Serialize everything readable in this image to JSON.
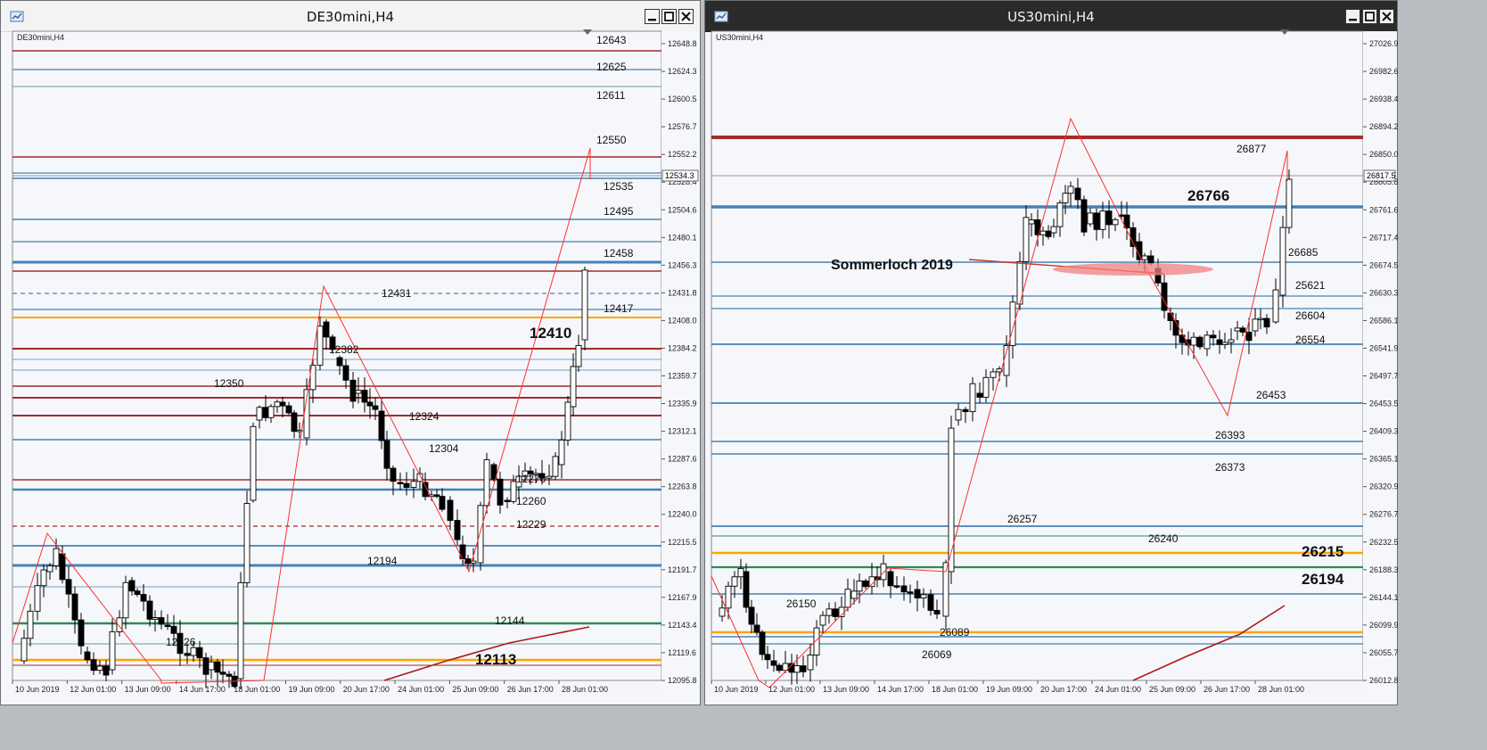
{
  "windows": [
    {
      "title": "DE30mini,H4",
      "symbol_label": "DE30mini,H4",
      "price_ticks": [
        "12648.8",
        "12624.3",
        "12600.5",
        "12576.7",
        "12552.2",
        "12528.4",
        "12504.6",
        "12480.1",
        "12456.3",
        "12431.8",
        "12408.0",
        "12384.2",
        "12359.7",
        "12335.9",
        "12312.1",
        "12287.6",
        "12263.8",
        "12240.0",
        "12215.5",
        "12191.7",
        "12167.9",
        "12143.4",
        "12119.6",
        "12095.8"
      ],
      "current_price": "12534.3",
      "time_ticks": [
        "10 Jun 2019",
        "12 Jun 01:00",
        "13 Jun 09:00",
        "14 Jun 17:00",
        "18 Jun 01:00",
        "19 Jun 09:00",
        "20 Jun 17:00",
        "24 Jun 01:00",
        "25 Jun 09:00",
        "26 Jun 17:00",
        "28 Jun 01:00"
      ],
      "level_labels": [
        {
          "text": "12643",
          "big": false
        },
        {
          "text": "12625",
          "big": false
        },
        {
          "text": "12611",
          "big": false
        },
        {
          "text": "12550",
          "big": false
        },
        {
          "text": "12535",
          "big": false
        },
        {
          "text": "12495",
          "big": false
        },
        {
          "text": "12458",
          "big": false
        },
        {
          "text": "12431",
          "big": false
        },
        {
          "text": "12417",
          "big": false
        },
        {
          "text": "12410",
          "big": true
        },
        {
          "text": "12382",
          "big": false
        },
        {
          "text": "12350",
          "big": false
        },
        {
          "text": "12324",
          "big": false
        },
        {
          "text": "12304",
          "big": false
        },
        {
          "text": "12270",
          "big": false
        },
        {
          "text": "12260",
          "big": false
        },
        {
          "text": "12229",
          "big": false
        },
        {
          "text": "12194",
          "big": false
        },
        {
          "text": "12144",
          "big": false
        },
        {
          "text": "12126",
          "big": false
        },
        {
          "text": "12113",
          "big": true
        }
      ]
    },
    {
      "title": "US30mini,H4",
      "symbol_label": "US30mini,H4",
      "price_ticks": [
        "27026.9",
        "26982.6",
        "26938.4",
        "26894.2",
        "26850.0",
        "26805.8",
        "26761.6",
        "26717.4",
        "26674.5",
        "26630.3",
        "26586.1",
        "26541.9",
        "26497.7",
        "26453.5",
        "26409.3",
        "26365.1",
        "26320.9",
        "26276.7",
        "26232.5",
        "26188.3",
        "26144.1",
        "26099.9",
        "26055.7",
        "26012.8"
      ],
      "current_price": "26817.5",
      "time_ticks": [
        "10 Jun 2019",
        "12 Jun 01:00",
        "13 Jun 09:00",
        "14 Jun 17:00",
        "18 Jun 01:00",
        "19 Jun 09:00",
        "20 Jun 17:00",
        "24 Jun 01:00",
        "25 Jun 09:00",
        "26 Jun 17:00",
        "28 Jun 01:00"
      ],
      "annotation": "Sommerloch 2019",
      "level_labels": [
        {
          "text": "26877",
          "big": false
        },
        {
          "text": "26766",
          "big": true
        },
        {
          "text": "26685",
          "big": false
        },
        {
          "text": "25621",
          "big": false
        },
        {
          "text": "26604",
          "big": false
        },
        {
          "text": "26554",
          "big": false
        },
        {
          "text": "26453",
          "big": false
        },
        {
          "text": "26393",
          "big": false
        },
        {
          "text": "26373",
          "big": false
        },
        {
          "text": "26257",
          "big": false
        },
        {
          "text": "26240",
          "big": false
        },
        {
          "text": "26215",
          "big": true
        },
        {
          "text": "26194",
          "big": true
        },
        {
          "text": "26150",
          "big": false
        },
        {
          "text": "26089",
          "big": false
        },
        {
          "text": "26069",
          "big": false
        }
      ]
    }
  ],
  "colors": {
    "red_level": "#a52a2a",
    "blue_level": "#4682b4",
    "orange_level": "#ffa500",
    "green_level": "#2e8b57",
    "zigzag": "#ff3030",
    "candle": "#000000"
  },
  "icons": [
    "app-icon",
    "minimize-icon",
    "maximize-icon",
    "close-icon",
    "scroll-marker-icon"
  ]
}
